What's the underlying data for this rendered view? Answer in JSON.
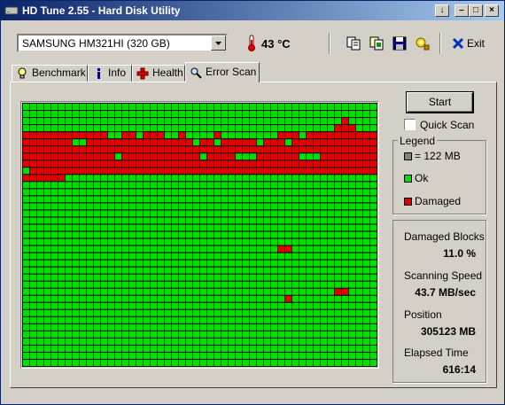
{
  "window": {
    "title": "HD Tune 2.55 - Hard Disk Utility"
  },
  "toolbar": {
    "drive": "SAMSUNG HM321HI (320 GB)",
    "temperature": "43 °C",
    "exit_label": "Exit"
  },
  "tabs": [
    {
      "label": "Benchmark",
      "icon": "lightbulb-icon"
    },
    {
      "label": "Info",
      "icon": "info-icon"
    },
    {
      "label": "Health",
      "icon": "health-cross-icon"
    },
    {
      "label": "Error Scan",
      "icon": "magnifier-icon",
      "active": true
    }
  ],
  "scan": {
    "start_label": "Start",
    "quick_scan_label": "Quick Scan",
    "quick_scan_checked": false
  },
  "legend": {
    "title": "Legend",
    "block_label": "= 122 MB",
    "ok_label": "Ok",
    "damaged_label": "Damaged",
    "colors": {
      "block": "#808080",
      "ok": "#00e000",
      "damaged": "#e00000"
    }
  },
  "stats": {
    "damaged_blocks_label": "Damaged Blocks",
    "damaged_blocks_value": "11.0 %",
    "speed_label": "Scanning Speed",
    "speed_value": "43.7 MB/sec",
    "position_label": "Position",
    "position_value": "305123 MB",
    "elapsed_label": "Elapsed Time",
    "elapsed_value": "616:14"
  },
  "block_map": {
    "columns": 50,
    "rows": 37,
    "rows_data": [
      "00000000000000000000000000000000000000000000000000",
      "00000000000000000000000000000000000000000000000000",
      "00000000000000000000000000000000000000000000000000",
      "00000000000000000000000000000000000000000000000000",
      "00000000000000000000000000000000000000000000000000",
      "00000000000000000000000000000000000000000000000000",
      "00000000000000000000000000000000000000000000000000",
      "00000000000000000000000000000000000000000000000000",
      "00000000000000000000000000000000000000000000000000",
      "00000000000000000000000000000000000000000000000000",
      "00000000000000000000000000000000000000000000000000",
      "00000000000000000000000000000000000000000000000000",
      "00000000000000000000000000000000000000000000000000",
      "00000000000000000000000000000000000000000000000000",
      "00000000000000000000000000000000000000000000000000",
      "00000000000000000000000000000000000000000000000000",
      "00000000000000000000000000000000000000000000000000",
      "00000000000000000000000000000000000000000000000000",
      "00000000000000000000000000000000000000000000000000",
      "00000000000000000000000000000000000000000000000000",
      "00000000000000000000000000000000000000000000000000",
      "00000000000000000000000000000000000000000000000000",
      "00000000000000000000000000000000000000000000000000",
      "00000000000000000000000000000000000000000000000000",
      "00000000000000000000000000000000000000000000000000",
      "00000000000000000000000000000000000000000000000000",
      "00000000000000000000000000000000000000000000000000",
      "00000000000000000000000000000000000000000000000000",
      "00000000000000000000000000000000000000000000000000",
      "00000000000000000000000000000000000000000000000000",
      "00000000000000000000000000000000000000000000000000",
      "00000000000000000000000000000000000000000000000000",
      "00000000000000000000000000000000000000000000000000",
      "00000000000000000000000000000000000000000000000000",
      "00000000000000000000000000000000000000000000000000",
      "00000000000000000000000000000000000000000000000000",
      "00000000000000000000000000000000000000000000000000"
    ],
    "damaged_rows": {
      "1": "00000000000000000000000000000000000000000000000000",
      "2": "00000000000000000000000000000000000000000000010000",
      "3": "00000000000000000000000000000000000000000000111000",
      "4": "11111111111100110111001000010000000011101111111111",
      "5": "11111110011111111111111101101111101110111111111111",
      "6": "11111111111111111111111111111111111111111111111111",
      "7": "11111111111110111111111110111100011111100011111111",
      "8": "11111111111111111111111111111111111111111111111111",
      "9": "01111111111111111111111111111111111111111111111111",
      "10": "11111100000000000000000000000000000000000000000000",
      "20": "00000000000000000000000000000000000011000000000000",
      "26": "00000000000000000000000000000000000000000000110000",
      "27": "00000000000000000000000000000000000001000000000000"
    }
  }
}
